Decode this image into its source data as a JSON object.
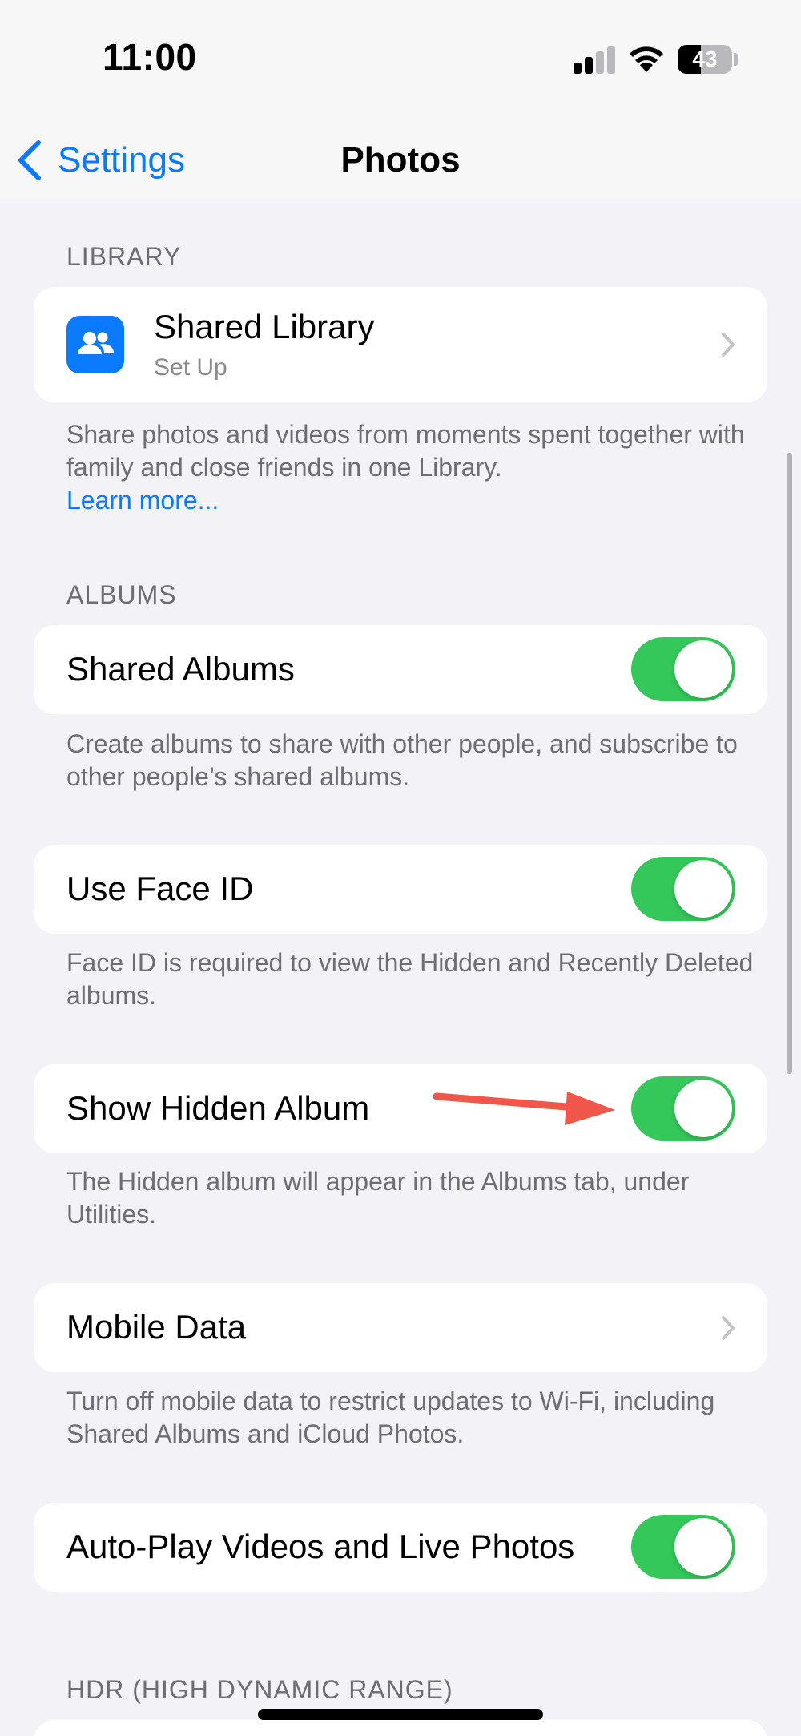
{
  "status_bar": {
    "time": "11:00",
    "battery_percent": "43",
    "battery_level": 0.43,
    "signal_bars": 2,
    "icons": [
      "cellular-signal-icon",
      "wifi-icon",
      "battery-icon"
    ]
  },
  "nav": {
    "back_label": "Settings",
    "title": "Photos"
  },
  "library": {
    "header": "LIBRARY",
    "item_title": "Shared Library",
    "item_subtitle": "Set Up",
    "footer": "Share photos and videos from moments spent together with family and close friends in one Library.",
    "footer_link": "Learn more..."
  },
  "albums": {
    "header": "ALBUMS",
    "shared_albums": {
      "label": "Shared Albums",
      "on": true
    },
    "shared_albums_footer": "Create albums to share with other people, and subscribe to other people’s shared albums."
  },
  "face_id": {
    "label": "Use Face ID",
    "on": true,
    "footer": "Face ID is required to view the Hidden and Recently Deleted albums."
  },
  "hidden_album": {
    "label": "Show Hidden Album",
    "on": true,
    "footer": "The Hidden album will appear in the Albums tab, under Utilities."
  },
  "mobile_data": {
    "label": "Mobile Data",
    "footer": "Turn off mobile data to restrict updates to Wi-Fi, including Shared Albums and iCloud Photos."
  },
  "autoplay": {
    "label": "Auto-Play Videos and Live Photos",
    "on": true
  },
  "hdr": {
    "header": "HDR (HIGH DYNAMIC RANGE)"
  },
  "colors": {
    "accent": "#0a7aff",
    "toggle_on": "#34c759",
    "background": "#f2f2f7",
    "annotation_arrow": "#f0564a"
  }
}
